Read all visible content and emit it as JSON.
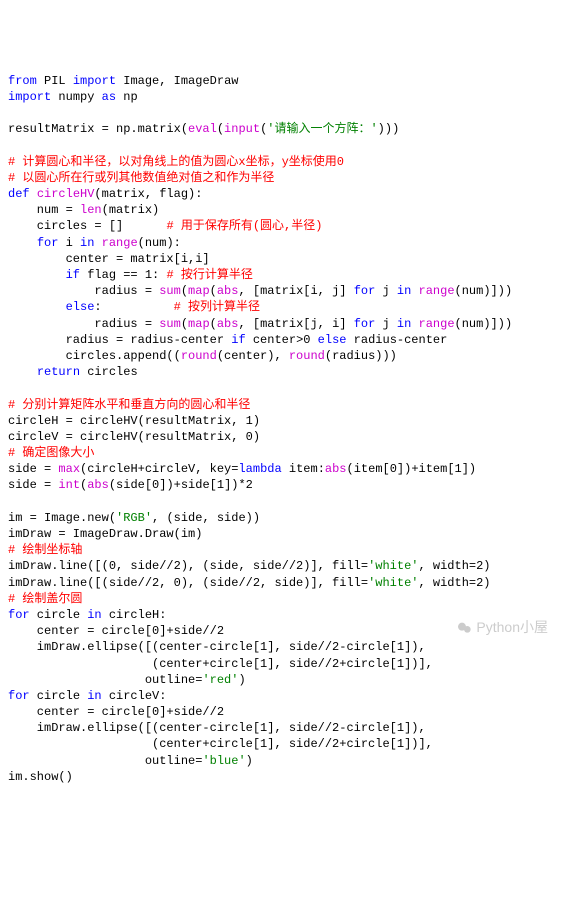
{
  "lines": [
    [
      [
        "kw",
        "from"
      ],
      [
        "",
        " PIL "
      ],
      [
        "kw",
        "import"
      ],
      [
        "",
        " Image, ImageDraw"
      ]
    ],
    [
      [
        "kw",
        "import"
      ],
      [
        "",
        " numpy "
      ],
      [
        "kw",
        "as"
      ],
      [
        "",
        " np"
      ]
    ],
    [
      [
        "",
        ""
      ]
    ],
    [
      [
        "",
        "resultMatrix = np.matrix("
      ],
      [
        "fn",
        "eval"
      ],
      [
        "",
        "("
      ],
      [
        "fn",
        "input"
      ],
      [
        "",
        "("
      ],
      [
        "str",
        "'请输入一个方阵：'"
      ],
      [
        "",
        ")))"
      ]
    ],
    [
      [
        "",
        ""
      ]
    ],
    [
      [
        "cmt",
        "# 计算圆心和半径，以对角线上的值为圆心x坐标，y坐标使用0"
      ]
    ],
    [
      [
        "cmt",
        "# 以圆心所在行或列其他数值绝对值之和作为半径"
      ]
    ],
    [
      [
        "kw",
        "def"
      ],
      [
        "",
        " "
      ],
      [
        "fn",
        "circleHV"
      ],
      [
        "",
        "(matrix, flag):"
      ]
    ],
    [
      [
        "",
        "    num = "
      ],
      [
        "fn",
        "len"
      ],
      [
        "",
        "(matrix)"
      ]
    ],
    [
      [
        "",
        "    circles = []      "
      ],
      [
        "cmt",
        "# 用于保存所有(圆心,半径)"
      ]
    ],
    [
      [
        "",
        "    "
      ],
      [
        "kw",
        "for"
      ],
      [
        "",
        " i "
      ],
      [
        "kw",
        "in"
      ],
      [
        "",
        " "
      ],
      [
        "fn",
        "range"
      ],
      [
        "",
        "(num):"
      ]
    ],
    [
      [
        "",
        "        center = matrix[i,i]"
      ]
    ],
    [
      [
        "",
        "        "
      ],
      [
        "kw",
        "if"
      ],
      [
        "",
        " flag == 1: "
      ],
      [
        "cmt",
        "# 按行计算半径"
      ]
    ],
    [
      [
        "",
        "            radius = "
      ],
      [
        "fn",
        "sum"
      ],
      [
        "",
        "("
      ],
      [
        "fn",
        "map"
      ],
      [
        "",
        "("
      ],
      [
        "fn",
        "abs"
      ],
      [
        "",
        ", [matrix[i, j] "
      ],
      [
        "kw",
        "for"
      ],
      [
        "",
        " j "
      ],
      [
        "kw",
        "in"
      ],
      [
        "",
        " "
      ],
      [
        "fn",
        "range"
      ],
      [
        "",
        "(num)]))"
      ]
    ],
    [
      [
        "",
        "        "
      ],
      [
        "kw",
        "else"
      ],
      [
        "",
        ":          "
      ],
      [
        "cmt",
        "# 按列计算半径"
      ]
    ],
    [
      [
        "",
        "            radius = "
      ],
      [
        "fn",
        "sum"
      ],
      [
        "",
        "("
      ],
      [
        "fn",
        "map"
      ],
      [
        "",
        "("
      ],
      [
        "fn",
        "abs"
      ],
      [
        "",
        ", [matrix[j, i] "
      ],
      [
        "kw",
        "for"
      ],
      [
        "",
        " j "
      ],
      [
        "kw",
        "in"
      ],
      [
        "",
        " "
      ],
      [
        "fn",
        "range"
      ],
      [
        "",
        "(num)]))"
      ]
    ],
    [
      [
        "",
        "        radius = radius-center "
      ],
      [
        "kw",
        "if"
      ],
      [
        "",
        " center>0 "
      ],
      [
        "kw",
        "else"
      ],
      [
        "",
        " radius-center"
      ]
    ],
    [
      [
        "",
        "        circles.append(("
      ],
      [
        "fn",
        "round"
      ],
      [
        "",
        "(center), "
      ],
      [
        "fn",
        "round"
      ],
      [
        "",
        "(radius)))"
      ]
    ],
    [
      [
        "",
        "    "
      ],
      [
        "kw",
        "return"
      ],
      [
        "",
        " circles"
      ]
    ],
    [
      [
        "",
        ""
      ]
    ],
    [
      [
        "cmt",
        "# 分别计算矩阵水平和垂直方向的圆心和半径"
      ]
    ],
    [
      [
        "",
        "circleH = circleHV(resultMatrix, 1)"
      ]
    ],
    [
      [
        "",
        "circleV = circleHV(resultMatrix, 0)"
      ]
    ],
    [
      [
        "cmt",
        "# 确定图像大小"
      ]
    ],
    [
      [
        "",
        "side = "
      ],
      [
        "fn",
        "max"
      ],
      [
        "",
        "(circleH+circleV, key="
      ],
      [
        "kw",
        "lambda"
      ],
      [
        "",
        " item:"
      ],
      [
        "fn",
        "abs"
      ],
      [
        "",
        "(item[0])+item[1])"
      ]
    ],
    [
      [
        "",
        "side = "
      ],
      [
        "fn",
        "int"
      ],
      [
        "",
        "("
      ],
      [
        "fn",
        "abs"
      ],
      [
        "",
        "(side[0])+side[1])*2"
      ]
    ],
    [
      [
        "",
        ""
      ]
    ],
    [
      [
        "",
        "im = Image.new("
      ],
      [
        "str",
        "'RGB'"
      ],
      [
        "",
        ", (side, side))"
      ]
    ],
    [
      [
        "",
        "imDraw = ImageDraw.Draw(im)"
      ]
    ],
    [
      [
        "cmt",
        "# 绘制坐标轴"
      ]
    ],
    [
      [
        "",
        "imDraw.line([(0, side//2), (side, side//2)], fill="
      ],
      [
        "str",
        "'white'"
      ],
      [
        "",
        ", width=2)"
      ]
    ],
    [
      [
        "",
        "imDraw.line([(side//2, 0), (side//2, side)], fill="
      ],
      [
        "str",
        "'white'"
      ],
      [
        "",
        ", width=2)"
      ]
    ],
    [
      [
        "cmt",
        "# 绘制盖尔圆"
      ]
    ],
    [
      [
        "kw",
        "for"
      ],
      [
        "",
        " circle "
      ],
      [
        "kw",
        "in"
      ],
      [
        "",
        " circleH:"
      ]
    ],
    [
      [
        "",
        "    center = circle[0]+side//2"
      ]
    ],
    [
      [
        "",
        "    imDraw.ellipse([(center-circle[1], side//2-circle[1]),"
      ]
    ],
    [
      [
        "",
        "                    (center+circle[1], side//2+circle[1])],"
      ]
    ],
    [
      [
        "",
        "                   outline="
      ],
      [
        "str",
        "'red'"
      ],
      [
        "",
        ")"
      ]
    ],
    [
      [
        "kw",
        "for"
      ],
      [
        "",
        " circle "
      ],
      [
        "kw",
        "in"
      ],
      [
        "",
        " circleV:"
      ]
    ],
    [
      [
        "",
        "    center = circle[0]+side//2"
      ]
    ],
    [
      [
        "",
        "    imDraw.ellipse([(center-circle[1], side//2-circle[1]),"
      ]
    ],
    [
      [
        "",
        "                    (center+circle[1], side//2+circle[1])],"
      ]
    ],
    [
      [
        "",
        "                   outline="
      ],
      [
        "str",
        "'blue'"
      ],
      [
        "",
        ")"
      ]
    ],
    [
      [
        "",
        "im.show()"
      ]
    ]
  ],
  "watermark": "Python小屋"
}
